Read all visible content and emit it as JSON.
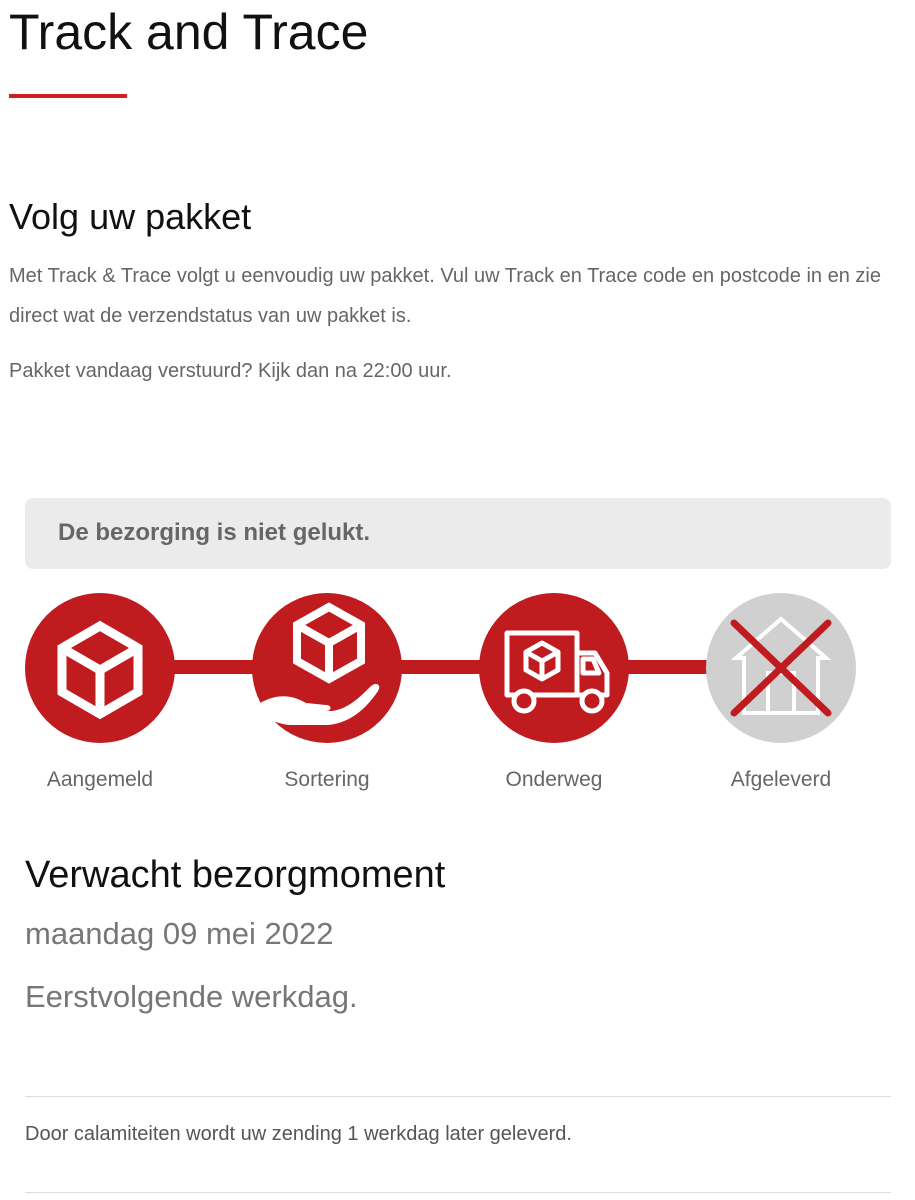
{
  "header": {
    "title": "Track and Trace"
  },
  "intro": {
    "title": "Volg uw pakket",
    "text": "Met Track & Trace volgt u eenvoudig uw pakket. Vul uw Track en Trace code en postcode in en zie direct wat de verzendstatus van uw pakket is.",
    "hint": "Pakket vandaag verstuurd? Kijk dan na 22:00 uur."
  },
  "status": {
    "message": "De bezorging is niet gelukt."
  },
  "timeline": {
    "steps": [
      {
        "label": "Aangemeld",
        "icon": "package-icon",
        "state": "completed"
      },
      {
        "label": "Sortering",
        "icon": "package-in-hand-icon",
        "state": "completed"
      },
      {
        "label": "Onderweg",
        "icon": "delivery-truck-icon",
        "state": "completed"
      },
      {
        "label": "Afgeleverd",
        "icon": "delivered-house-crossed-icon",
        "state": "failed"
      }
    ],
    "colors": {
      "active": "#c01b1e",
      "inactive": "#d0d0d0",
      "cross": "#c01b1e"
    }
  },
  "expected": {
    "title": "Verwacht bezorgmoment",
    "date": "maandag 09 mei 2022",
    "note": "Eerstvolgende werkdag."
  },
  "notice": {
    "text": "Door calamiteiten wordt uw zending 1 werkdag later geleverd."
  }
}
